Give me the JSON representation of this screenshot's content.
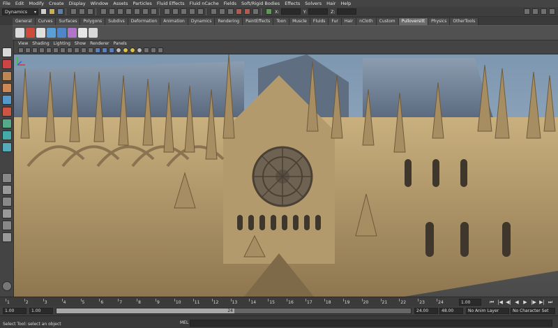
{
  "menubar": {
    "items": [
      "File",
      "Edit",
      "Modify",
      "Create",
      "Display",
      "Window",
      "Assets",
      "Particles",
      "Fluid Effects",
      "Fluid nCache",
      "Fields",
      "Soft/Rigid Bodies",
      "Effects",
      "Solvers",
      "Hair",
      "Help"
    ]
  },
  "statusline": {
    "mode": "Dynamics",
    "x_label": "X:",
    "y_label": "Y:",
    "z_label": "Z:"
  },
  "shelf": {
    "tabs": [
      "General",
      "Curves",
      "Surfaces",
      "Polygons",
      "Subdivs",
      "Deformation",
      "Animation",
      "Dynamics",
      "Rendering",
      "PaintEffects",
      "Toon",
      "Muscle",
      "Fluids",
      "Fur",
      "Hair",
      "nCloth",
      "Custom",
      "Pulloversitt",
      "Physics",
      "OtherTools"
    ],
    "active_tab": "Pulloversitt"
  },
  "panel": {
    "menus": [
      "View",
      "Shading",
      "Lighting",
      "Show",
      "Renderer",
      "Panels"
    ]
  },
  "timeslider": {
    "ticks": [
      "1",
      "2",
      "3",
      "4",
      "5",
      "6",
      "7",
      "8",
      "9",
      "10",
      "11",
      "12",
      "13",
      "14",
      "15",
      "16",
      "17",
      "18",
      "19",
      "20",
      "21",
      "22",
      "23",
      "24"
    ],
    "current_time": "1.00"
  },
  "rangeslider": {
    "start_time": "1.00",
    "playback_start": "1.00",
    "handle_label": "24",
    "playback_end": "24.00",
    "end_time": "48.00",
    "anim_layer": "No Anim Layer",
    "character_set": "No Character Set"
  },
  "helpline": {
    "text": "Select Tool: select an object",
    "mel_label": "MEL"
  },
  "colors": {
    "ui_bg": "#444444",
    "active_tab": "#6a6a6a",
    "sky": "#8ea7bd",
    "stone": "#b39a6c",
    "roof": "#6f7f94"
  }
}
